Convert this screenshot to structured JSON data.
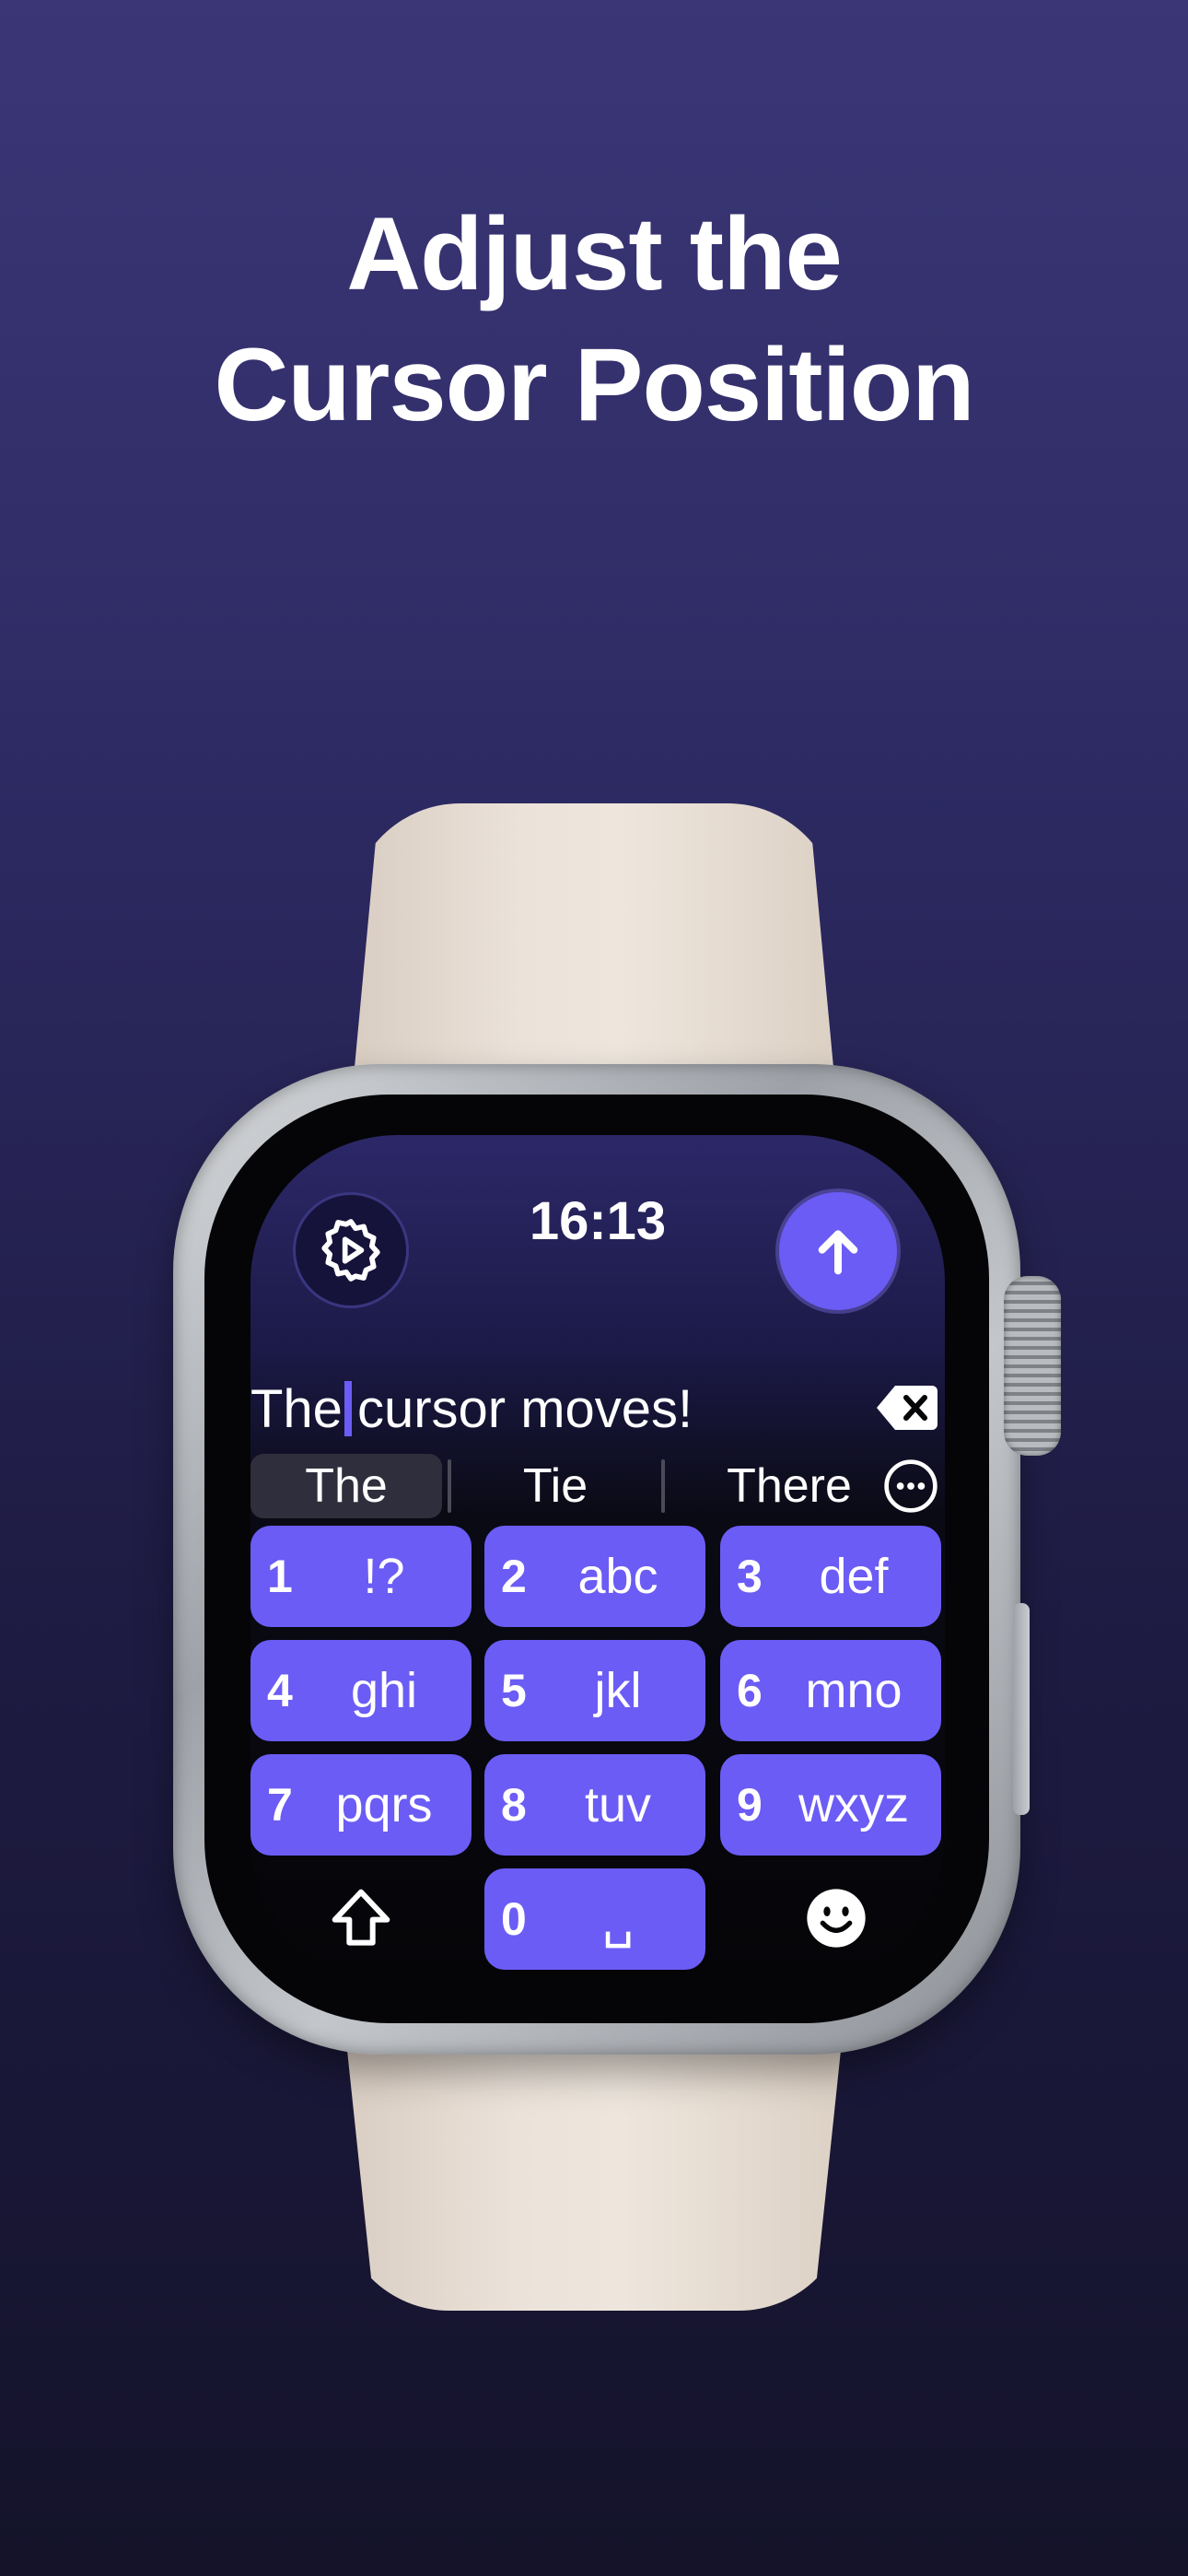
{
  "headline": {
    "line1": "Adjust the",
    "line2": "Cursor Position"
  },
  "watch": {
    "time": "16:13",
    "input": {
      "before_cursor": "The",
      "after_cursor": "cursor moves!"
    },
    "suggestions": [
      "The",
      "Tie",
      "There"
    ],
    "keys": [
      {
        "num": "1",
        "letters": "!?"
      },
      {
        "num": "2",
        "letters": "abc"
      },
      {
        "num": "3",
        "letters": "def"
      },
      {
        "num": "4",
        "letters": "ghi"
      },
      {
        "num": "5",
        "letters": "jkl"
      },
      {
        "num": "6",
        "letters": "mno"
      },
      {
        "num": "7",
        "letters": "pqrs"
      },
      {
        "num": "8",
        "letters": "tuv"
      },
      {
        "num": "9",
        "letters": "wxyz"
      },
      {
        "num": "0",
        "letters": "␣"
      }
    ],
    "icons": {
      "settings": "gear-play-icon",
      "send": "arrow-up-icon",
      "delete": "backspace-icon",
      "more": "ellipsis-circle-icon",
      "shift": "shift-arrow-icon",
      "emoji": "smiley-icon"
    },
    "colors": {
      "accent": "#6b5cf5",
      "band": "#e8ded4",
      "background_top": "#3b3777",
      "background_bottom": "#14132a"
    }
  }
}
